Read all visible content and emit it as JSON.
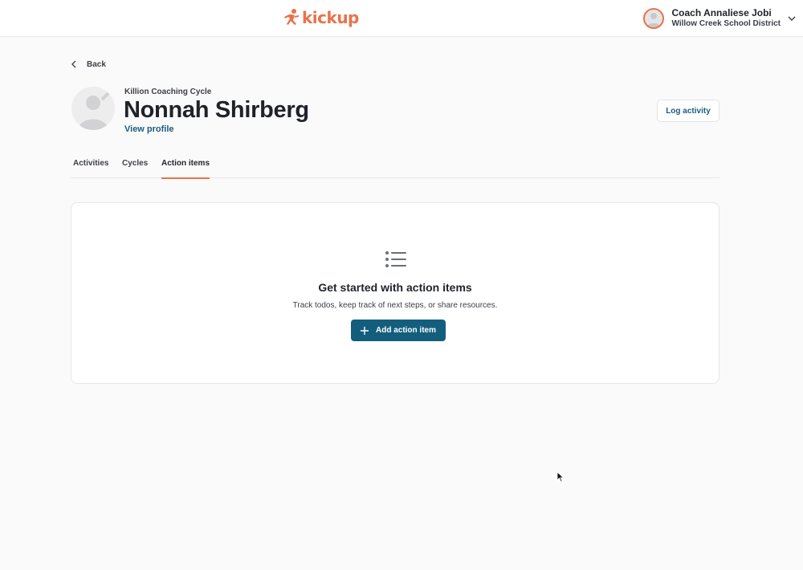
{
  "app": {
    "logo_text": "kickup",
    "brand_color": "#e8734a",
    "primary_color": "#145e7d"
  },
  "user": {
    "name": "Coach Annaliese Jobi",
    "district": "Willow Creek School District"
  },
  "nav": {
    "back_label": "Back"
  },
  "header": {
    "cycle": "Killion Coaching Cycle",
    "name": "Nonnah Shirberg",
    "view_profile": "View profile",
    "log_activity": "Log activity"
  },
  "tabs": [
    {
      "label": "Activities",
      "active": false
    },
    {
      "label": "Cycles",
      "active": false
    },
    {
      "label": "Action items",
      "active": true
    }
  ],
  "empty_state": {
    "icon": "list-icon",
    "title": "Get started with action items",
    "description": "Track todos, keep track of next steps, or share resources.",
    "button_label": "Add action item"
  }
}
